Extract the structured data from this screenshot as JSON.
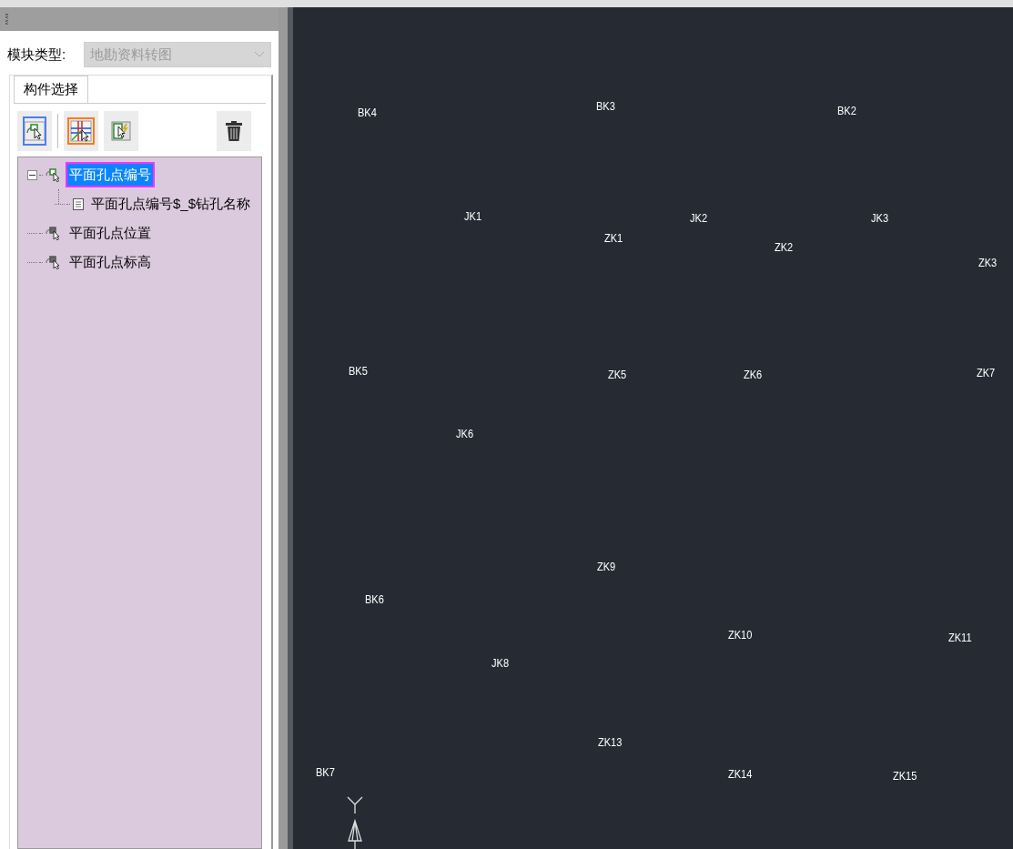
{
  "module_type": {
    "label": "模块类型:",
    "value": "地勘资料转图",
    "disabled": true
  },
  "tabs": [
    {
      "label": "构件选择",
      "selected": true
    }
  ],
  "toolbar": [
    {
      "kind": "select",
      "selected": true,
      "highlighted": false
    },
    {
      "kind": "grid-select",
      "selected": false,
      "highlighted": true
    },
    {
      "kind": "edit",
      "selected": false,
      "highlighted": false
    },
    {
      "kind": "delete",
      "selected": false,
      "highlighted": false
    }
  ],
  "tree": [
    {
      "label": "平面孔点编号",
      "kind": "group",
      "active": true,
      "expanded": true,
      "selected": true,
      "children": [
        {
          "label": "平面孔点编号$_$钻孔名称",
          "kind": "field",
          "selected": false
        }
      ]
    },
    {
      "label": "平面孔点位置",
      "kind": "group",
      "active": false,
      "selected": false
    },
    {
      "label": "平面孔点标高",
      "kind": "group",
      "active": false,
      "selected": false
    }
  ],
  "canvas_labels": [
    "BK4",
    "BK3",
    "BK2",
    "JK1",
    "JK2",
    "JK3",
    "ZK1",
    "ZK2",
    "ZK3",
    "BK5",
    "ZK5",
    "ZK6",
    "ZK7",
    "JK6",
    "ZK9",
    "BK6",
    "ZK10",
    "ZK11",
    "JK8",
    "ZK13",
    "BK7",
    "ZK14",
    "ZK15"
  ]
}
